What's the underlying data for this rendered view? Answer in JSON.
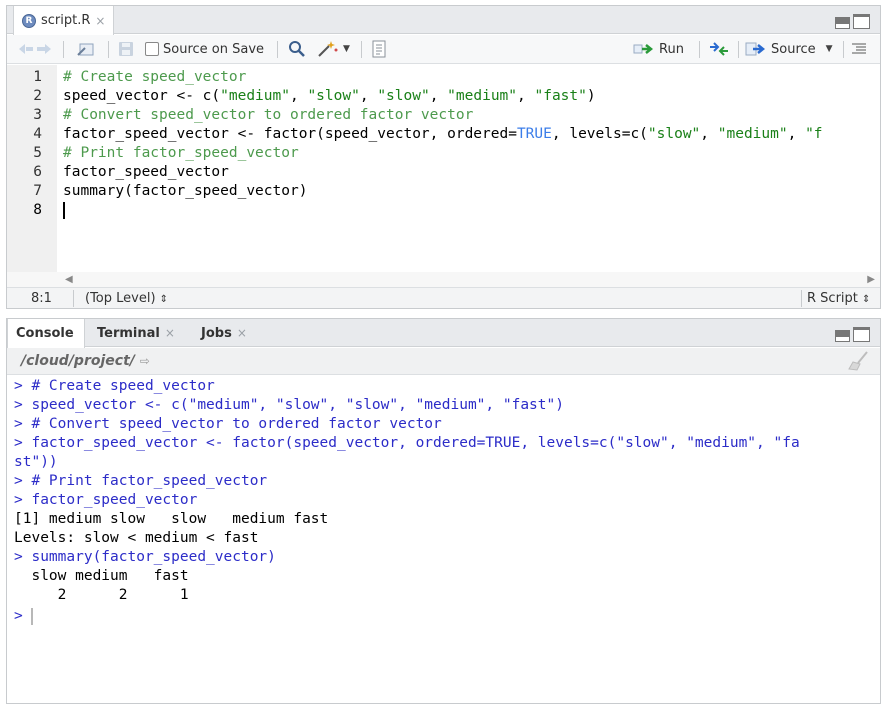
{
  "editor": {
    "tab_label": "script.R",
    "tab_close": "×",
    "source_on_save": "Source on Save",
    "run_label": "Run",
    "source_label": "Source",
    "lines": [
      {
        "num": "1",
        "segments": [
          {
            "cls": "cm",
            "text": "# Create speed_vector"
          }
        ]
      },
      {
        "num": "2",
        "segments": [
          {
            "cls": "",
            "text": "speed_vector <- c("
          },
          {
            "cls": "st",
            "text": "\"medium\""
          },
          {
            "cls": "",
            "text": ", "
          },
          {
            "cls": "st",
            "text": "\"slow\""
          },
          {
            "cls": "",
            "text": ", "
          },
          {
            "cls": "st",
            "text": "\"slow\""
          },
          {
            "cls": "",
            "text": ", "
          },
          {
            "cls": "st",
            "text": "\"medium\""
          },
          {
            "cls": "",
            "text": ", "
          },
          {
            "cls": "st",
            "text": "\"fast\""
          },
          {
            "cls": "",
            "text": ")"
          }
        ]
      },
      {
        "num": "3",
        "segments": [
          {
            "cls": "cm",
            "text": "# Convert speed_vector to ordered factor vector"
          }
        ]
      },
      {
        "num": "4",
        "segments": [
          {
            "cls": "",
            "text": "factor_speed_vector <- factor(speed_vector, ordered="
          },
          {
            "cls": "kw",
            "text": "TRUE"
          },
          {
            "cls": "",
            "text": ", levels=c("
          },
          {
            "cls": "st",
            "text": "\"slow\""
          },
          {
            "cls": "",
            "text": ", "
          },
          {
            "cls": "st",
            "text": "\"medium\""
          },
          {
            "cls": "",
            "text": ", "
          },
          {
            "cls": "st",
            "text": "\"f"
          }
        ]
      },
      {
        "num": "5",
        "segments": [
          {
            "cls": "cm",
            "text": "# Print factor_speed_vector"
          }
        ]
      },
      {
        "num": "6",
        "segments": [
          {
            "cls": "",
            "text": "factor_speed_vector"
          }
        ]
      },
      {
        "num": "7",
        "segments": [
          {
            "cls": "",
            "text": "summary(factor_speed_vector)"
          }
        ]
      },
      {
        "num": "8",
        "segments": []
      }
    ],
    "status_position": "8:1",
    "status_scope": "(Top Level)",
    "status_filetype": "R Script"
  },
  "console": {
    "tabs": [
      {
        "label": "Console",
        "close": ""
      },
      {
        "label": "Terminal",
        "close": "×"
      },
      {
        "label": "Jobs",
        "close": "×"
      }
    ],
    "path": "/cloud/project/",
    "lines": [
      {
        "cls": "in",
        "text": "> # Create speed_vector"
      },
      {
        "cls": "in",
        "text": "> speed_vector <- c(\"medium\", \"slow\", \"slow\", \"medium\", \"fast\")"
      },
      {
        "cls": "in",
        "text": "> # Convert speed_vector to ordered factor vector"
      },
      {
        "cls": "in",
        "text": "> factor_speed_vector <- factor(speed_vector, ordered=TRUE, levels=c(\"slow\", \"medium\", \"fa"
      },
      {
        "cls": "in",
        "text": "st\"))"
      },
      {
        "cls": "in",
        "text": "> # Print factor_speed_vector"
      },
      {
        "cls": "in",
        "text": "> factor_speed_vector"
      },
      {
        "cls": "out",
        "text": "[1] medium slow   slow   medium fast"
      },
      {
        "cls": "out",
        "text": "Levels: slow < medium < fast"
      },
      {
        "cls": "in",
        "text": "> summary(factor_speed_vector)"
      },
      {
        "cls": "out",
        "text": "  slow medium   fast"
      },
      {
        "cls": "out",
        "text": "     2      2      1"
      }
    ],
    "prompt": ">"
  }
}
